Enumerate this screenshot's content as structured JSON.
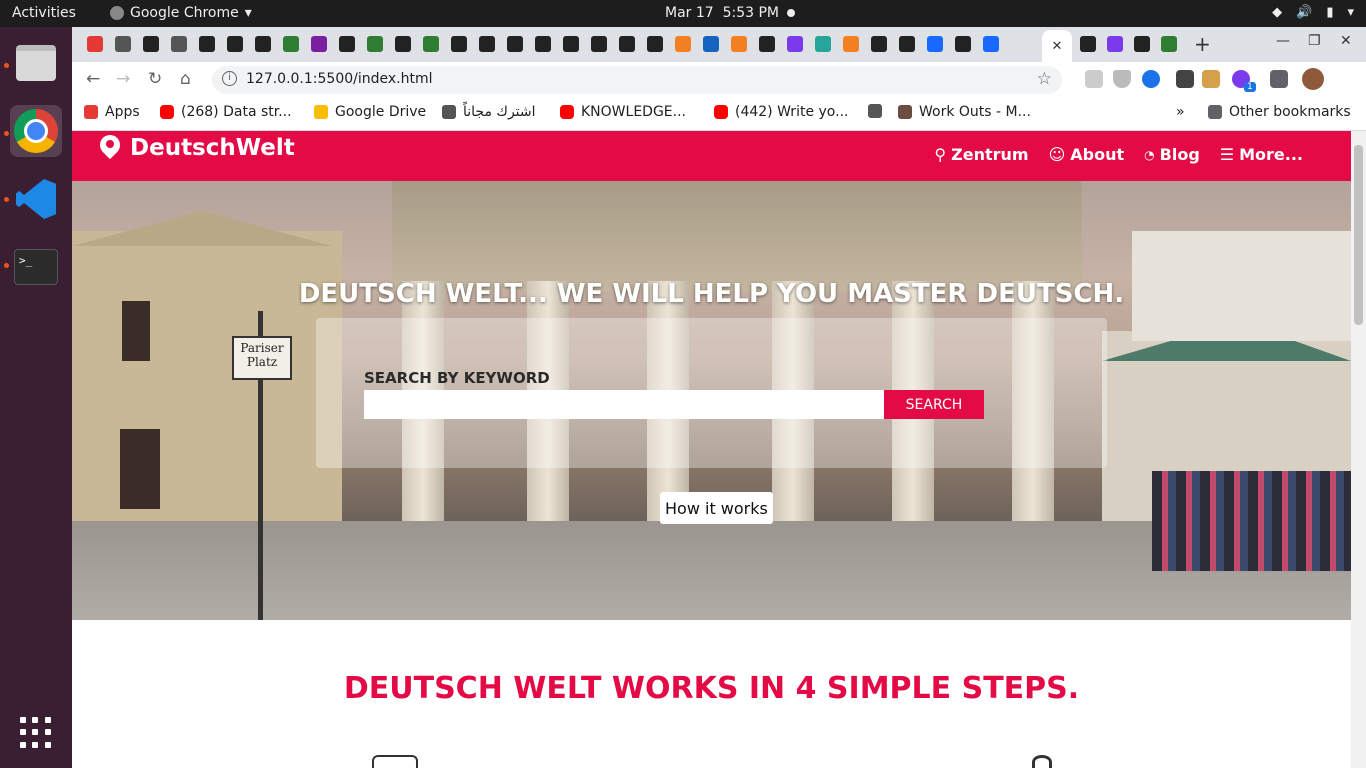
{
  "os": {
    "activities": "Activities",
    "app_name": "Google Chrome",
    "date": "Mar 17",
    "time": "5:53 PM"
  },
  "browser": {
    "url": "127.0.0.1:5500/index.html",
    "bookmarks": [
      {
        "label": "Apps"
      },
      {
        "label": "(268) Data str..."
      },
      {
        "label": "Google Drive"
      },
      {
        "label": "اشترك مجاناً"
      },
      {
        "label": "KNOWLEDGE..."
      },
      {
        "label": "(442) Write yo..."
      },
      {
        "label": ""
      },
      {
        "label": "Work Outs - M..."
      },
      {
        "label": "Other bookmarks"
      }
    ],
    "more_bookmarks": "»",
    "ext_badge": "1"
  },
  "site": {
    "brand": "DeutschWelt",
    "nav": [
      {
        "label": "Zentrum",
        "icon": "search-icon"
      },
      {
        "label": "About",
        "icon": "user-icon"
      },
      {
        "label": "Blog",
        "icon": "rss-icon"
      },
      {
        "label": "More...",
        "icon": "menu-icon"
      }
    ],
    "hero_title": "DEUTSCH WELT... WE WILL HELP YOU MASTER DEUTSCH.",
    "search_label": "SEARCH BY KEYWORD",
    "search_placeholder": "",
    "search_button": "SEARCH",
    "how_button": "How it works",
    "sign_text": "Pariser Platz",
    "steps_title": "DEUTSCH WELT WORKS IN 4 SIMPLE STEPS.",
    "brand_color": "#e40a46"
  }
}
